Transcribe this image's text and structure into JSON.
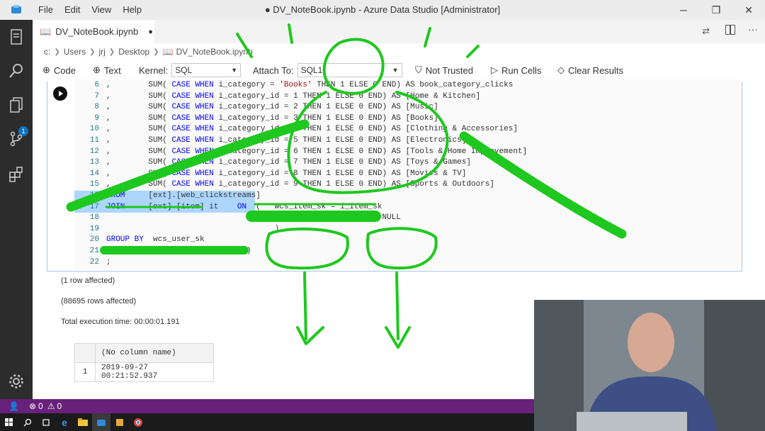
{
  "menu": {
    "file": "File",
    "edit": "Edit",
    "view": "View",
    "help": "Help"
  },
  "window": {
    "title": "● DV_NoteBook.ipynb - Azure Data Studio [Administrator]"
  },
  "tab": {
    "label": "DV_NoteBook.ipynb",
    "dirty": "●"
  },
  "breadcrumb": {
    "items": [
      "c:",
      "Users",
      "jrj",
      "Desktop",
      "DV_NoteBook.ipynb"
    ]
  },
  "toolbar": {
    "code": "Code",
    "text": "Text",
    "kernel_label": "Kernel:",
    "kernel_value": "SQL",
    "attach_label": "Attach To:",
    "attach_value": "SQL1",
    "not_trusted": "Not Trusted",
    "run_cells": "Run Cells",
    "clear_results": "Clear Results"
  },
  "activity": {
    "extensions_badge": "1"
  },
  "code": {
    "lines": [
      {
        "n": "6",
        "parts": [
          [
            ",",
            ""
          ],
          [
            "        SUM( ",
            ""
          ],
          [
            "CASE WHEN",
            "kw"
          ],
          [
            " i_category = ",
            ""
          ],
          [
            "'Books'",
            "str"
          ],
          [
            " THEN 1 ELSE 0 END) AS book_category_clicks",
            ""
          ]
        ]
      },
      {
        "n": "7",
        "parts": [
          [
            ",",
            ""
          ],
          [
            "        SUM( ",
            ""
          ],
          [
            "CASE WHEN",
            "kw"
          ],
          [
            " i_category_id = 1 THEN 1 ELSE 0 END) AS [Home & Kitchen]",
            ""
          ]
        ]
      },
      {
        "n": "8",
        "parts": [
          [
            ",",
            ""
          ],
          [
            "        SUM( ",
            ""
          ],
          [
            "CASE WHEN",
            "kw"
          ],
          [
            " i_category_id = 2 THEN 1 ELSE 0 END) AS [Music]",
            ""
          ]
        ]
      },
      {
        "n": "9",
        "parts": [
          [
            ",",
            ""
          ],
          [
            "        SUM( ",
            ""
          ],
          [
            "CASE WHEN",
            "kw"
          ],
          [
            " i_category_id = 3 THEN 1 ELSE 0 END) AS [Books]",
            ""
          ]
        ]
      },
      {
        "n": "10",
        "parts": [
          [
            ",",
            ""
          ],
          [
            "        SUM( ",
            ""
          ],
          [
            "CASE WHEN",
            "kw"
          ],
          [
            " i_category_id = 4 THEN 1 ELSE 0 END) AS [Clothing & Accessories]",
            ""
          ]
        ]
      },
      {
        "n": "11",
        "parts": [
          [
            ",",
            ""
          ],
          [
            "        SUM( ",
            ""
          ],
          [
            "CASE WHEN",
            "kw"
          ],
          [
            " i_category_id = 5 THEN 1 ELSE 0 END) AS [Electronics]",
            ""
          ]
        ]
      },
      {
        "n": "12",
        "parts": [
          [
            ",",
            ""
          ],
          [
            "        SUM( ",
            ""
          ],
          [
            "CASE WHEN",
            "kw"
          ],
          [
            " i_category_id = 6 THEN 1 ELSE 0 END) AS [Tools & Home Improvement]",
            ""
          ]
        ]
      },
      {
        "n": "13",
        "parts": [
          [
            ",",
            ""
          ],
          [
            "        SUM( ",
            ""
          ],
          [
            "CASE WHEN",
            "kw"
          ],
          [
            " i_category_id = 7 THEN 1 ELSE 0 END) AS [Toys & Games]",
            ""
          ]
        ]
      },
      {
        "n": "14",
        "parts": [
          [
            ",",
            ""
          ],
          [
            "        SUM( ",
            ""
          ],
          [
            "CASE WHEN",
            "kw"
          ],
          [
            " i_category_id = 8 THEN 1 ELSE 0 END) AS [Movies & TV]",
            ""
          ]
        ]
      },
      {
        "n": "15",
        "parts": [
          [
            ",",
            ""
          ],
          [
            "        SUM( ",
            ""
          ],
          [
            "CASE WHEN",
            "kw"
          ],
          [
            " i_category_id = 9 THEN 1 ELSE 0 END) AS [Sports & Outdoors]",
            ""
          ]
        ]
      },
      {
        "n": "16",
        "parts": [
          [
            "FROM",
            "kw"
          ],
          [
            "     [ext].[web_clickstreams]",
            ""
          ]
        ]
      },
      {
        "n": "17",
        "parts": [
          [
            "JOIN",
            "kw"
          ],
          [
            "     [ext].[item] it    ",
            ""
          ],
          [
            "ON",
            "kw"
          ],
          [
            "  (   wcs_item_sk = i_item_sk",
            ""
          ]
        ]
      },
      {
        "n": "18",
        "parts": [
          [
            "                                    AND wcs_user_sk IS NOT NULL",
            ""
          ]
        ]
      },
      {
        "n": "19",
        "parts": [
          [
            "                                    )",
            ""
          ]
        ]
      },
      {
        "n": "20",
        "parts": [
          [
            "GROUP BY",
            "kw"
          ],
          [
            "  wcs_user_sk",
            ""
          ]
        ]
      },
      {
        "n": "21",
        "parts": [
          [
            "OPTION (FORCE EXTERNALPUSHDOWN)",
            ""
          ]
        ]
      },
      {
        "n": "22",
        "parts": [
          [
            ";",
            ""
          ]
        ]
      }
    ]
  },
  "output": {
    "row1": "(1 row affected)",
    "row2": "(88695 rows affected)",
    "exec_time": "Total execution time: 00:00:01.191",
    "table": {
      "header": "(No column name)",
      "row_num": "1",
      "value": "2019-09-27 00:21:52.937"
    }
  },
  "status": {
    "errors": "0",
    "warnings": "0"
  },
  "colors": {
    "accent": "#68217a",
    "ink": "#1ec81e",
    "link": "#0e70c0"
  }
}
